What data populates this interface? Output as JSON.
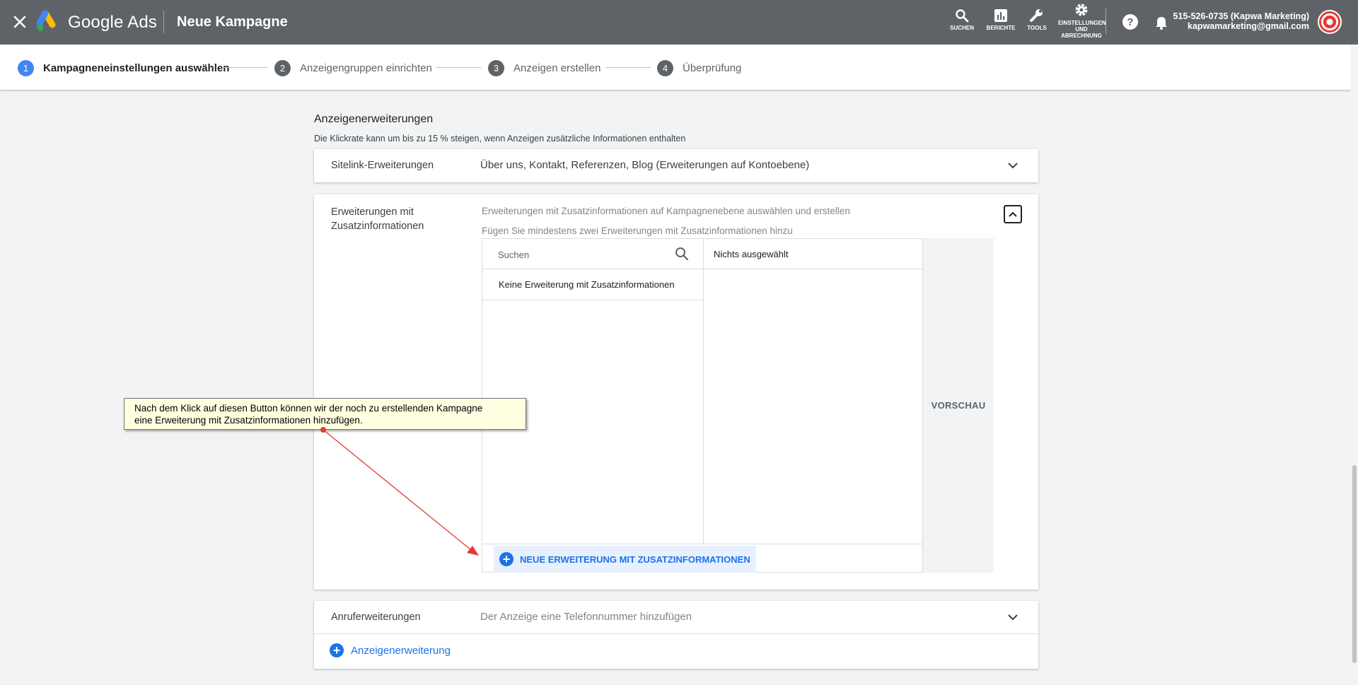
{
  "header": {
    "brand": "Google Ads",
    "page_title": "Neue Kampagne",
    "tools": [
      {
        "label": "SUCHEN",
        "icon": "search-icon"
      },
      {
        "label": "BERICHTE",
        "icon": "bar-chart-icon"
      },
      {
        "label": "TOOLS",
        "icon": "wrench-icon"
      },
      {
        "label_lines": [
          "EINSTELLUNGEN",
          "UND",
          "ABRECHNUNG"
        ],
        "icon": "gear-icon"
      }
    ],
    "account_name": "515-526-0735 (Kapwa Marketing)",
    "account_email": "kapwamarketing@gmail.com"
  },
  "stepper": {
    "steps": [
      {
        "num": "1",
        "label": "Kampagneneinstellungen auswählen",
        "active": true
      },
      {
        "num": "2",
        "label": "Anzeigengruppen einrichten",
        "active": false
      },
      {
        "num": "3",
        "label": "Anzeigen erstellen",
        "active": false
      },
      {
        "num": "4",
        "label": "Überprüfung",
        "active": false
      }
    ]
  },
  "section": {
    "title": "Anzeigenerweiterungen",
    "subtitle": "Die Klickrate kann um bis zu 15 % steigen, wenn Anzeigen zusätzliche Informationen enthalten"
  },
  "sitelink": {
    "label": "Sitelink-Erweiterungen",
    "value": "Über uns, Kontakt, Referenzen, Blog (Erweiterungen auf Kontoebene)"
  },
  "callout": {
    "label_line1": "Erweiterungen mit",
    "label_line2": "Zusatzinformationen",
    "description": "Erweiterungen mit Zusatzinformationen auf Kampagnenebene auswählen und erstellen",
    "hint": "Fügen Sie mindestens zwei Erweiterungen mit Zusatzinformationen hinzu",
    "search_placeholder": "Suchen",
    "empty_list": "Keine Erweiterung mit Zusatzinformationen",
    "selected_header": "Nichts ausgewählt",
    "new_button": "NEUE ERWEITERUNG MIT ZUSATZINFORMATIONEN",
    "preview": "VORSCHAU"
  },
  "call": {
    "label": "Anruferweiterungen",
    "value": "Der Anzeige eine Telefonnummer hinzufügen",
    "add_link": "Anzeigenerweiterung"
  },
  "tooltip": {
    "line1": "Nach dem Klick auf diesen Button können wir der noch zu erstellenden Kampagne",
    "line2": "eine Erweiterung mit Zusatzinformationen hinzufügen."
  },
  "colors": {
    "header_bg": "#5f6368",
    "accent_blue": "#1a73e8",
    "step_active": "#4285f4",
    "tooltip_bg": "#ffffe1",
    "arrow": "#e53935"
  }
}
